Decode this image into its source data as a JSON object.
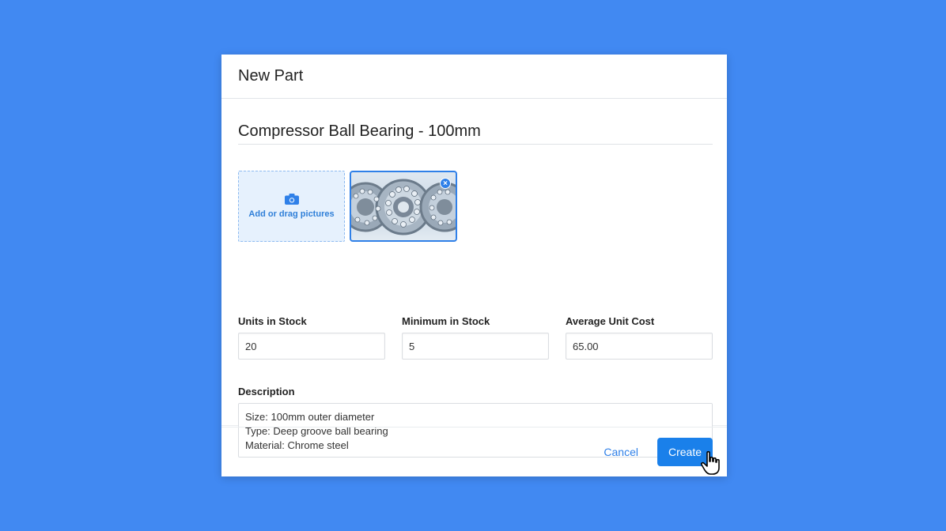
{
  "modal": {
    "title": "New Part",
    "part_name": "Compressor Ball Bearing - 100mm",
    "pictures": {
      "add_label": "Add or drag pictures",
      "add_icon": "camera-icon",
      "remove_icon": "close-icon",
      "remove_glyph": "×",
      "thumbnail_alt": "Ball bearings"
    },
    "fields": [
      {
        "label": "Units in Stock",
        "value": "20"
      },
      {
        "label": "Minimum in Stock",
        "value": "5"
      },
      {
        "label": "Average Unit Cost",
        "value": "65.00"
      }
    ],
    "description": {
      "label": "Description",
      "value": "Size: 100mm outer diameter\nType: Deep groove ball bearing\nMaterial: Chrome steel"
    },
    "footer": {
      "cancel_label": "Cancel",
      "create_label": "Create"
    }
  },
  "colors": {
    "background": "#4189F2",
    "accent": "#1a80ea"
  }
}
